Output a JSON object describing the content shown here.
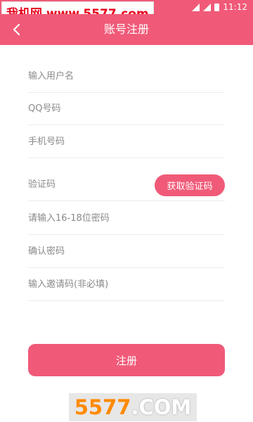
{
  "status_bar": {
    "time": "11:12",
    "bg_color": "#f05a78"
  },
  "watermark_top": {
    "text": "我机网 www.5577.com"
  },
  "app_bar": {
    "title": "账号注册",
    "back_icon": "chevron-left-icon",
    "accent_color": "#f05a78"
  },
  "form": {
    "username": {
      "placeholder": "输入用户名",
      "value": ""
    },
    "qq": {
      "placeholder": "QQ号码",
      "value": ""
    },
    "phone": {
      "placeholder": "手机号码",
      "value": ""
    },
    "verify_code": {
      "placeholder": "验证码",
      "value": "",
      "button_label": "获取验证码"
    },
    "password": {
      "placeholder": "请输入16-18位密码",
      "value": ""
    },
    "confirm_password": {
      "placeholder": "确认密码",
      "value": ""
    },
    "invite_code": {
      "placeholder": "输入邀请码(非必填)",
      "value": ""
    }
  },
  "register_button": {
    "label": "注册"
  },
  "watermark_bottom": {
    "number": "5577",
    "suffix": ".COM"
  }
}
